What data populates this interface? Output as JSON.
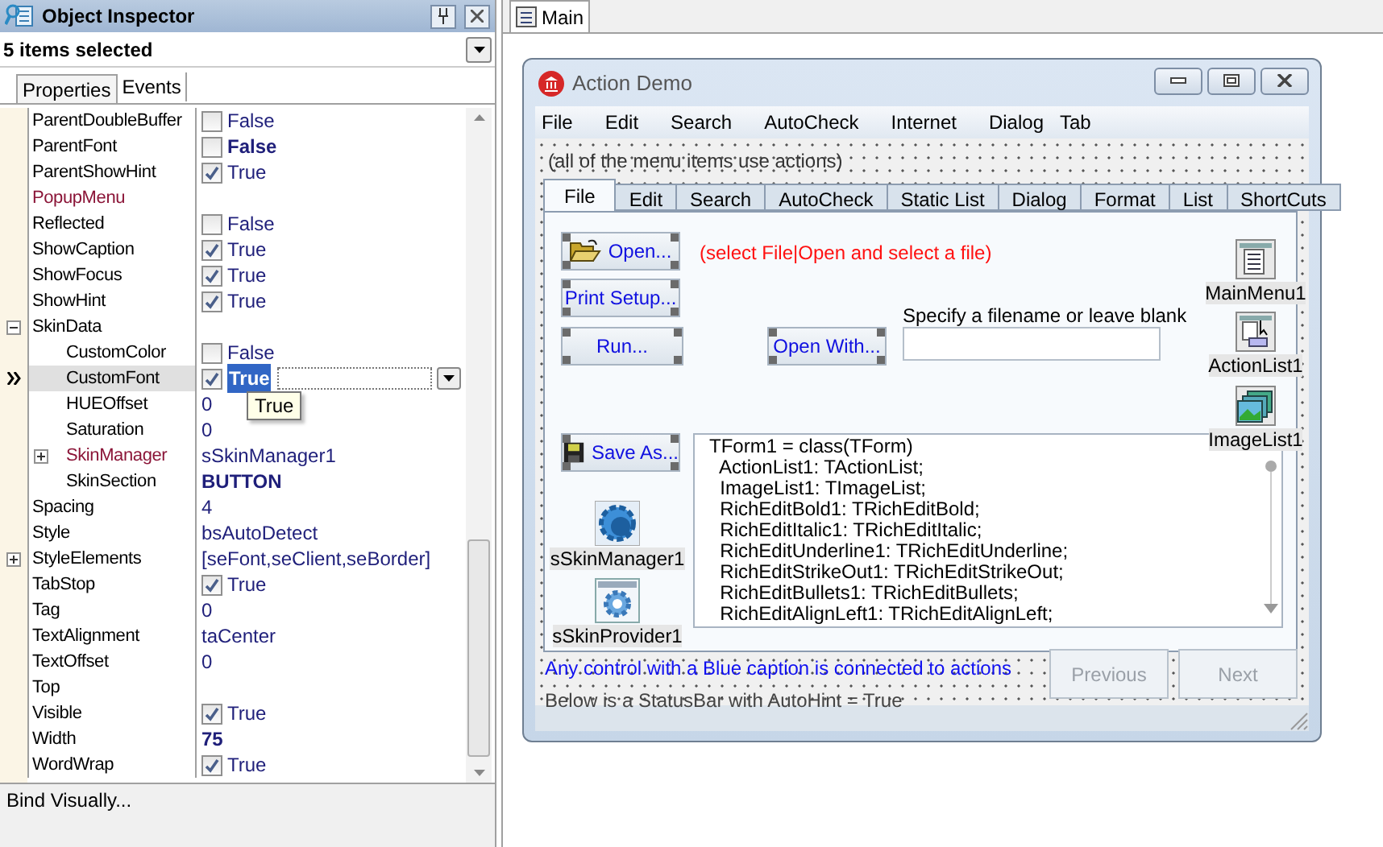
{
  "inspector": {
    "title": "Object Inspector",
    "selector": "5 items selected",
    "tabs": [
      {
        "label": "Properties",
        "selected": true
      },
      {
        "label": "Events",
        "selected": false
      }
    ],
    "properties": [
      {
        "name": "ParentDoubleBuffer",
        "kind": "check",
        "checked": false,
        "value": "False",
        "bold": false,
        "reference": false,
        "selected": false
      },
      {
        "name": "ParentFont",
        "kind": "check",
        "checked": false,
        "value": "False",
        "bold": true,
        "reference": false,
        "selected": false
      },
      {
        "name": "ParentShowHint",
        "kind": "check",
        "checked": true,
        "value": "True",
        "bold": false,
        "reference": false,
        "selected": false
      },
      {
        "name": "PopupMenu",
        "kind": "text",
        "reference": true,
        "selected": false
      },
      {
        "name": "Reflected",
        "kind": "check",
        "checked": false,
        "value": "False",
        "bold": false,
        "reference": false,
        "selected": false
      },
      {
        "name": "ShowCaption",
        "kind": "check",
        "checked": true,
        "value": "True",
        "bold": false,
        "reference": false,
        "selected": false
      },
      {
        "name": "ShowFocus",
        "kind": "check",
        "checked": true,
        "value": "True",
        "bold": false,
        "reference": false,
        "selected": false
      },
      {
        "name": "ShowHint",
        "kind": "check",
        "checked": true,
        "value": "True",
        "bold": false,
        "reference": false,
        "selected": false
      },
      {
        "name": "SkinData",
        "kind": "text",
        "reference": false,
        "selected": false,
        "expanded": true,
        "children": [
          {
            "name": "CustomColor",
            "kind": "check",
            "checked": false,
            "value": "False",
            "bold": false,
            "reference": false,
            "selected": false
          },
          {
            "name": "CustomFont",
            "kind": "check",
            "checked": true,
            "value": "True",
            "bold": true,
            "reference": false,
            "selected": true,
            "hint": "True"
          },
          {
            "name": "HUEOffset",
            "kind": "text",
            "value": "0",
            "bold": false,
            "reference": false,
            "selected": false
          },
          {
            "name": "Saturation",
            "kind": "text",
            "value": "0",
            "bold": false,
            "reference": false,
            "selected": false
          },
          {
            "name": "SkinManager",
            "kind": "text",
            "value": "sSkinManager1",
            "bold": false,
            "reference": true,
            "selected": false,
            "expanded": false
          },
          {
            "name": "SkinSection",
            "kind": "text",
            "value": "BUTTON",
            "bold": true,
            "reference": false,
            "selected": false
          }
        ]
      },
      {
        "name": "Spacing",
        "kind": "text",
        "value": "4",
        "bold": false,
        "reference": false,
        "selected": false
      },
      {
        "name": "Style",
        "kind": "text",
        "value": "bsAutoDetect",
        "bold": false,
        "reference": false,
        "selected": false
      },
      {
        "name": "StyleElements",
        "kind": "text",
        "value": "[seFont,seClient,seBorder]",
        "bold": false,
        "reference": false,
        "selected": false,
        "expanded": false
      },
      {
        "name": "TabStop",
        "kind": "check",
        "checked": true,
        "value": "True",
        "bold": false,
        "reference": false,
        "selected": false
      },
      {
        "name": "Tag",
        "kind": "text",
        "value": "0",
        "bold": false,
        "reference": false,
        "selected": false
      },
      {
        "name": "TextAlignment",
        "kind": "text",
        "value": "taCenter",
        "bold": false,
        "reference": false,
        "selected": false
      },
      {
        "name": "TextOffset",
        "kind": "text",
        "value": "0",
        "bold": false,
        "reference": false,
        "selected": false
      },
      {
        "name": "Top",
        "kind": "text",
        "reference": false,
        "selected": false
      },
      {
        "name": "Visible",
        "kind": "check",
        "checked": true,
        "value": "True",
        "bold": false,
        "reference": false,
        "selected": false
      },
      {
        "name": "Width",
        "kind": "text",
        "value": "75",
        "bold": true,
        "reference": false,
        "selected": false
      },
      {
        "name": "WordWrap",
        "kind": "check",
        "checked": true,
        "value": "True",
        "bold": false,
        "reference": false,
        "selected": false
      }
    ],
    "status": "Bind Visually..."
  },
  "designer": {
    "tabs": [
      {
        "label": "Main",
        "selected": true
      }
    ],
    "form": {
      "title": "Action Demo",
      "menu": [
        {
          "label": "File"
        },
        {
          "label": "Edit"
        },
        {
          "label": "Search"
        },
        {
          "label": "AutoCheck"
        },
        {
          "label": "Internet"
        },
        {
          "label": "Dialog"
        },
        {
          "label": "Tab"
        }
      ],
      "note": "(all of the menu items use actions)",
      "page_tabs": [
        {
          "label": "File",
          "selected": true
        },
        {
          "label": "Edit",
          "selected": false
        },
        {
          "label": "Search",
          "selected": false
        },
        {
          "label": "AutoCheck",
          "selected": false
        },
        {
          "label": "Static List",
          "selected": false
        },
        {
          "label": "Dialog",
          "selected": false
        },
        {
          "label": "Format",
          "selected": false
        },
        {
          "label": "List",
          "selected": false
        },
        {
          "label": "ShortCuts",
          "selected": false
        }
      ],
      "buttons": [
        {
          "label": "Open...",
          "selected": true
        },
        {
          "label": "Print Setup...",
          "selected": true
        },
        {
          "label": "Run...",
          "selected": true
        },
        {
          "label": "Open With...",
          "selected": true
        },
        {
          "label": "Save As...",
          "selected": true
        }
      ],
      "hint_text": "(select File|Open and select a file)",
      "filename_label": "Specify a filename or leave blank",
      "components": [
        {
          "label": "MainMenu1",
          "kind": "menu"
        },
        {
          "label": "ActionList1",
          "kind": "actions"
        },
        {
          "label": "ImageList1",
          "kind": "images"
        },
        {
          "label": "sSkinManager1",
          "kind": "skin"
        },
        {
          "label": "sSkinProvider1",
          "kind": "provider"
        }
      ],
      "memo_lines": [
        "TForm1 = class(TForm)",
        "  ActionList1: TActionList;",
        "  ImageList1: TImageList;",
        "  RichEditBold1: TRichEditBold;",
        "  RichEditItalic1: TRichEditItalic;",
        "  RichEditUnderline1: TRichEditUnderline;",
        "  RichEditStrikeOut1: TRichEditStrikeOut;",
        "  RichEditBullets1: TRichEditBullets;",
        "  RichEditAlignLeft1: TRichEditAlignLeft;"
      ],
      "caption_note": "Any control with a Blue caption is connected to actions",
      "statusbar_note": "Below is a StatusBar with AutoHint = True",
      "nav_buttons": [
        {
          "label": "Previous",
          "disabled": true
        },
        {
          "label": "Next",
          "disabled": true
        }
      ]
    }
  }
}
